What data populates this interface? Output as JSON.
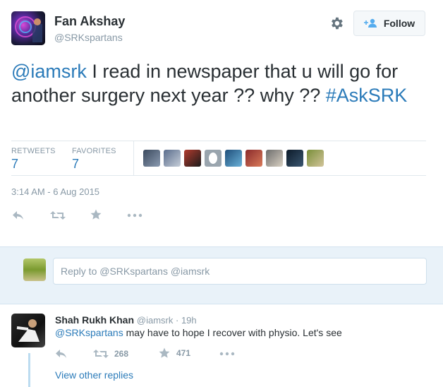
{
  "tweet": {
    "author_name": "Fan Akshay",
    "author_handle": "@SRKspartans",
    "follow_label": "Follow",
    "text_mention": "@iamsrk",
    "text_body": " I read in newspaper that u will go for another surgery next year ?? why ?? ",
    "text_hashtag": "#AskSRK",
    "retweets_label": "RETWEETS",
    "retweets_count": "7",
    "favorites_label": "FAVORITES",
    "favorites_count": "7",
    "timestamp": "3:14 AM - 6 Aug 2015"
  },
  "reply_box": {
    "placeholder": "Reply to @SRKspartans @iamsrk"
  },
  "reply": {
    "author_name": "Shah Rukh Khan",
    "author_handle": "@iamsrk",
    "separator": " · ",
    "time": "19h",
    "text_mention": "@SRKspartans",
    "text_body": " may have to hope I recover with physio. Let's see",
    "retweet_count": "268",
    "favorite_count": "471",
    "view_replies": "View other replies"
  },
  "icons": {
    "settings": "gear-icon",
    "follow": "add-user-icon",
    "reply": "reply-icon",
    "retweet": "retweet-icon",
    "favorite": "star-icon",
    "more": "more-icon"
  },
  "colors": {
    "link": "#2b7bb9",
    "muted": "#8899a6",
    "text": "#292f33",
    "reply_bg": "#e9f2f9"
  }
}
